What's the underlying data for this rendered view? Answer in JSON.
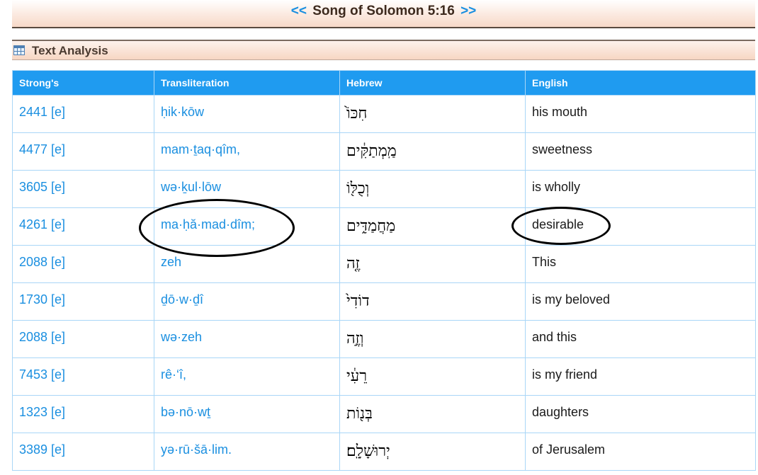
{
  "navigation": {
    "prev": "<<",
    "verse": "Song of Solomon 5:16",
    "next": ">>"
  },
  "section": {
    "title": "Text Analysis",
    "icon": "table-icon"
  },
  "table": {
    "headers": [
      "Strong's",
      "Transliteration",
      "Hebrew",
      "English"
    ],
    "rows": [
      {
        "strongs": "2441 [e]",
        "translit": "ḥik·kōw",
        "hebrew": "חִכּוֹ֙",
        "english": "his mouth"
      },
      {
        "strongs": "4477 [e]",
        "translit": "mam·ṯaq·qîm,",
        "hebrew": "מַֽמְתַקִּ֔ים",
        "english": "sweetness"
      },
      {
        "strongs": "3605 [e]",
        "translit": "wə·ḵul·lōw",
        "hebrew": "וְכֻלּ֖וֹ",
        "english": "is wholly"
      },
      {
        "strongs": "4261 [e]",
        "translit": "ma·ḥă·mad·dîm;",
        "hebrew": "מַחֲמַדִּ֑ים",
        "english": "desirable"
      },
      {
        "strongs": "2088 [e]",
        "translit": "zeh",
        "hebrew": "זֶ֤ה",
        "english": "This"
      },
      {
        "strongs": "1730 [e]",
        "translit": "ḏō·w·ḏî",
        "hebrew": "דוֹדִי֙",
        "english": "is my beloved"
      },
      {
        "strongs": "2088 [e]",
        "translit": "wə·zeh",
        "hebrew": "וְזֶ֣ה",
        "english": "and this"
      },
      {
        "strongs": "7453 [e]",
        "translit": "rê·‘î,",
        "hebrew": "רֵעִ֔י",
        "english": "is my friend"
      },
      {
        "strongs": "1323 [e]",
        "translit": "bə·nō·wṯ",
        "hebrew": "בְּנ֖וֹת",
        "english": "daughters"
      },
      {
        "strongs": "3389 [e]",
        "translit": "yə·rū·šā·lim.",
        "hebrew": "יְרוּשָׁלִָֽם׃",
        "english": "of Jerusalem"
      }
    ]
  },
  "colors": {
    "header_bg": "#1f9bf0",
    "link": "#1a8fe0",
    "border": "#a9d6f7"
  }
}
